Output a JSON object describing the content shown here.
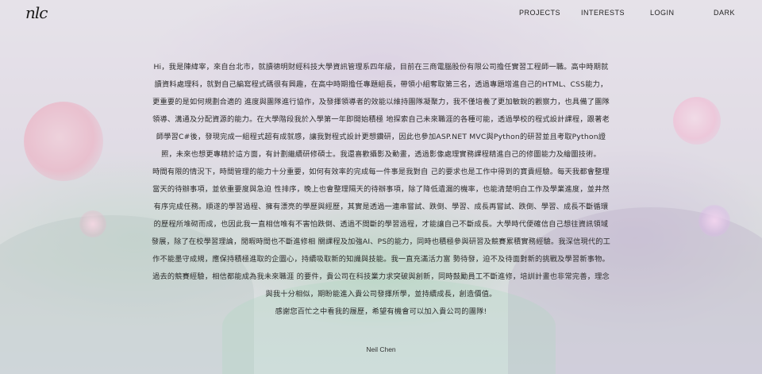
{
  "header": {
    "logo": "nlc",
    "nav": [
      {
        "label": "PROJECTS"
      },
      {
        "label": "INTERESTS"
      },
      {
        "label": "LOGIN"
      },
      {
        "label": "DARK"
      }
    ]
  },
  "about": {
    "paragraphs": [
      "Hi，我是陳緯宰，來自台北市，就讀德明財經科技大學資訊管理系四年級，目前在三商電腦股份有限公司擔任實習工程師一職。高中時期就讀資料處理科，就對自己編寫程式碼很有興趣，在高中時期擔任專題組長，帶領小組奪取第三名，透過專題增進自己的HTML、CSS能力，更重要的是如何規劃合適的 進度與團隊進行協作，及發揮領導者的效能以維持團隊凝聚力，我不僅培養了更加敏銳的觀察力，也具備了團隊領導、溝通及分配資源的能力。在大學階段我於入學第一年即開始積極 地探索自己未來職涯的各種可能，透過學校的程式設計課程，跟著老師學習C#後，發現完成一組程式超有成就感，讓我對程式設計更想鑽研，因此也參加ASP.NET MVC與Python的研習並且考取Python證照，未來也想更專精於這方面，有計劃繼續研修碩士。我還喜歡攝影及動畫，透過影像處理實務課程精進自己的修圖能力及繪圖技術。",
      "時間有限的情況下，時間管理的能力十分重要，如何有效率的完成每一件事是我對自 己的要求也是工作中得到的寶貴經驗。每天我都會整理當天的待辦事項，並依重要度與急迫 性排序，晚上也會整理隔天的待辦事項，除了降低遺漏的機率，也能清楚明白工作及學業進度，並井然有序完成任務。順遂的學習過程、擁有漂亮的學歷與經歷，其實是透過一連串嘗試、跌倒、學習、成長再嘗試、跌倒、學習、成長不斷循環的歷程所堆砌而成，也因此我一直相信唯有不害怕跌倒、透過不間斷的學習過程，才能讓自己不斷成長。大學時代便確信自己想往資訊領域發展，除了在校學習理論，閒暇時間也不斷進修相 關課程及加強AI、PS的能力，同時也積極參與研習及競賽累積實務經驗。我深信現代的工 作不能墨守成規，應保持積極進取的企圖心，持續吸取新的知識與技能。我一直充滿活力富 勢待發，迫不及待面對新的挑戰及學習新事物。過去的競賽經驗，相信都能成為我未來職涯 的要件，貴公司在科技業力求突破與創新，同時鼓勵員工不斷進修，培訓計畫也非常完善，理念與我十分相似，期盼能進入貴公司發揮所學，並持續成長，創造價值。",
      "感謝您百忙之中看我的履歷，希望有機會可以加入貴公司的團隊!"
    ],
    "signature": "Neil Chen"
  }
}
